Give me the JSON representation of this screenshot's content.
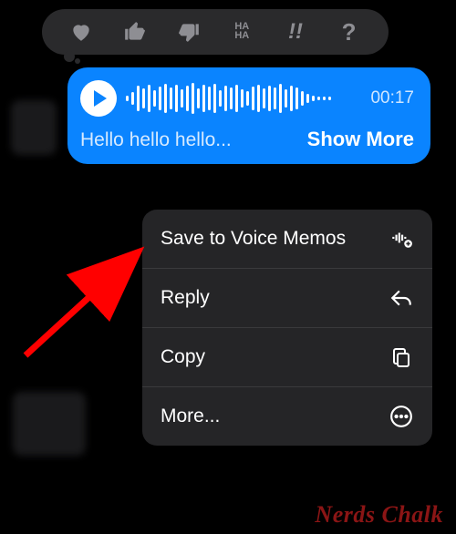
{
  "reactions": {
    "heart": "heart",
    "thumbs_up": "thumbs-up",
    "thumbs_down": "thumbs-down",
    "haha": "HA HA",
    "exclaim": "!!",
    "question": "?"
  },
  "voice_message": {
    "duration": "00:17",
    "transcript": "Hello hello hello...",
    "show_more_label": "Show More"
  },
  "menu": {
    "save_voice_memos": "Save to Voice Memos",
    "reply": "Reply",
    "copy": "Copy",
    "more": "More..."
  },
  "watermark": "Nerds Chalk"
}
